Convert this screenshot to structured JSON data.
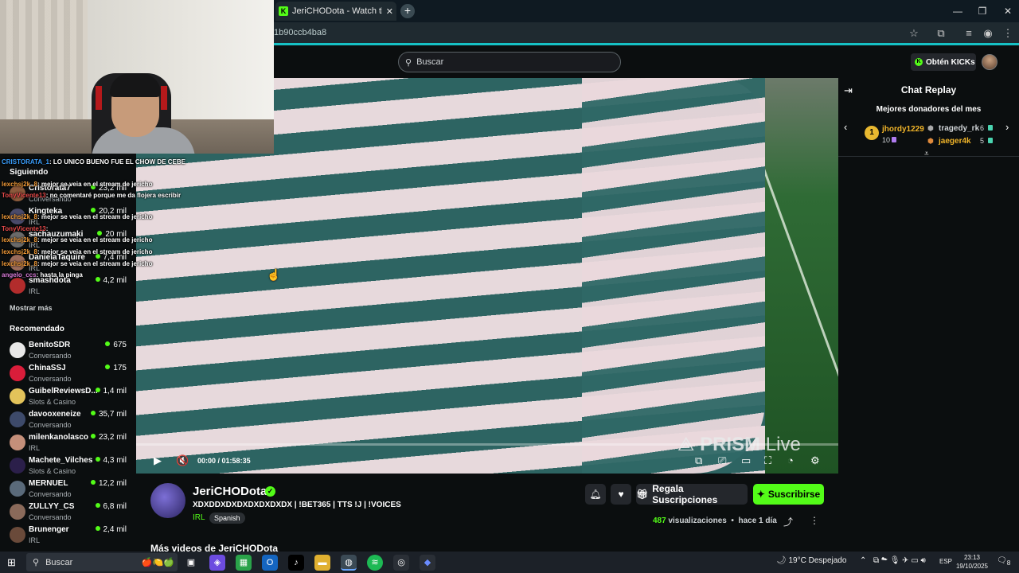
{
  "browser": {
    "tab_title": "JeriCHODota - Watch the VOD",
    "url": "1b90ccb4ba8",
    "accent": "#16c1c5"
  },
  "header": {
    "search_placeholder": "Buscar",
    "get_kicks_label": "Obtén KICKs",
    "brand_color": "#53fc18"
  },
  "chat_overlay": [
    {
      "user": "CRISTORATA_1",
      "message": ": LO UNICO BUENO FUE EL CHOW DE CEBE"
    },
    {
      "user": "lexchsj2k_8",
      "message": ": mejor se veia en el stream de jericho"
    },
    {
      "user": "TonyVicente13",
      "message": ": no comentaré porque me da flojera escribir"
    },
    {
      "user": "lexchsj2k_8",
      "message": ": mejor se veia en el stream de jericho"
    },
    {
      "user": "TonyVicente13",
      "message": ":"
    },
    {
      "user": "lexchsj2k_8",
      "message": ": mejor se veia en el stream de jericho"
    },
    {
      "user": "lexchsj2k_8",
      "message": ": mejor se veia en el stream de jericho"
    },
    {
      "user": "lexchsj2k_8",
      "message": ": mejor se veia en el stream de jericho"
    },
    {
      "user": "angelo_ccs",
      "message": ": hasta la pinga"
    }
  ],
  "sidebar": {
    "following_label": "Siguiendo",
    "following": [
      {
        "name": "Cristorata7",
        "category": "Conversando",
        "viewers": "23,2 mil"
      },
      {
        "name": "Kingteka",
        "category": "IRL",
        "viewers": "20,2 mil"
      },
      {
        "name": "sachauzumaki",
        "category": "IRL",
        "viewers": "20 mil"
      },
      {
        "name": "DanielaTaquire",
        "category": "IRL",
        "viewers": "7,4 mil"
      },
      {
        "name": "smashdota",
        "category": "IRL",
        "viewers": "4,2 mil"
      }
    ],
    "show_more_label": "Mostrar más",
    "recommended_label": "Recomendado",
    "recommended": [
      {
        "name": "BenitoSDR",
        "category": "Conversando",
        "viewers": "675"
      },
      {
        "name": "ChinaSSJ",
        "category": "Conversando",
        "viewers": "175"
      },
      {
        "name": "GuibelReviewsD...",
        "category": "Slots & Casino",
        "viewers": "1,4 mil"
      },
      {
        "name": "davooxeneize",
        "category": "Conversando",
        "viewers": "35,7 mil"
      },
      {
        "name": "milenkanolasco",
        "category": "IRL",
        "viewers": "23,2 mil"
      },
      {
        "name": "Machete_Vilches",
        "category": "Slots & Casino",
        "viewers": "4,3 mil"
      },
      {
        "name": "MERNUEL",
        "category": "Conversando",
        "viewers": "12,2 mil"
      },
      {
        "name": "ZULLYY_CS",
        "category": "Conversando",
        "viewers": "6,8 mil"
      },
      {
        "name": "Brunenger",
        "category": "IRL",
        "viewers": "2,4 mil"
      }
    ]
  },
  "video": {
    "watermark_a": "PRISM",
    "watermark_b": " Live",
    "time_current": "00:00",
    "time_total": "01:58:35"
  },
  "channel": {
    "name": "JeriCHODota",
    "title": "XDXDDXDXDXDXDXDXDX  | !BET365 | TTS !J | !VOICES",
    "category": "IRL",
    "language": "Spanish",
    "gift_label": "Regala Suscripciones",
    "subscribe_label": "Suscribirse",
    "views_count": "487",
    "views_label": " visualizaciones",
    "time_ago": "hace 1 día",
    "more_videos": "Más videos de JeriCHODota"
  },
  "chat_replay": {
    "title": "Chat Replay",
    "donors_title": "Mejores donadores del mes",
    "top_donor": {
      "rank": "1",
      "name": "jhordy1229",
      "amount": "10"
    },
    "donors": [
      {
        "name": "tragedy_rk",
        "amount": "6"
      },
      {
        "name": "jaeger4k",
        "amount": "5"
      }
    ]
  },
  "taskbar": {
    "search_label": "Buscar",
    "weather": "19°C  Despejado",
    "language": "ESP",
    "time": "23:13",
    "date": "19/10/2025",
    "notifications": "8"
  }
}
